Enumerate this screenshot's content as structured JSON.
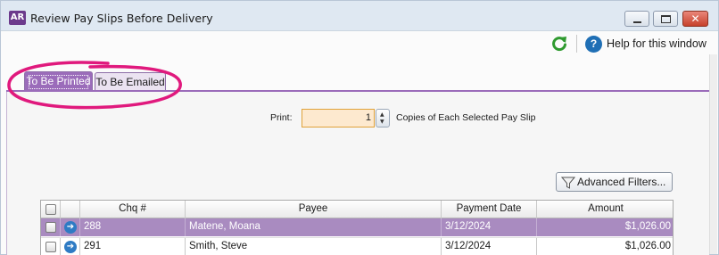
{
  "window": {
    "app_icon": "AR",
    "title": "Review Pay Slips Before Delivery",
    "controls": {
      "minimize_icon": "minimize-icon",
      "maximize_icon": "maximize-icon",
      "close_icon": "close-icon",
      "close_glyph": "✕"
    }
  },
  "toolbar": {
    "refresh_icon": "refresh-icon",
    "help_icon": "help-icon",
    "help_glyph": "?",
    "help_label": "Help for this window"
  },
  "tabs": [
    {
      "label": "To Be Printed",
      "active": true
    },
    {
      "label": "To Be Emailed",
      "active": false
    }
  ],
  "print": {
    "label": "Print:",
    "copies_value": "1",
    "copies_suffix": "Copies of Each Selected Pay Slip",
    "spin_up": "▲",
    "spin_down": "▼"
  },
  "filters": {
    "advanced_label": "Advanced Filters...",
    "icon": "funnel-icon"
  },
  "table": {
    "columns": [
      "",
      "",
      "Chq #",
      "Payee",
      "Payment Date",
      "Amount"
    ],
    "rows": [
      {
        "chq": "288",
        "payee": "Matene, Moana",
        "date": "3/12/2024",
        "amount": "$1,026.00",
        "selected": true
      },
      {
        "chq": "291",
        "payee": "Smith, Steve",
        "date": "3/12/2024",
        "amount": "$1,026.00",
        "selected": false
      }
    ]
  },
  "colors": {
    "accent": "#9b6cba",
    "selected_row": "#a98bc0",
    "input_highlight": "#fde9cf",
    "annotation": "#e0197d"
  }
}
